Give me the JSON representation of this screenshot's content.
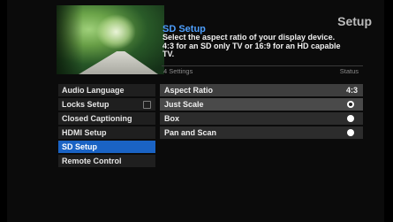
{
  "screen": {
    "title": "Setup"
  },
  "description": {
    "title": "SD Setup",
    "body": "Select the aspect ratio of your display device. 4:3 for an SD only TV or 16:9 for an HD capable TV."
  },
  "info": {
    "left": "4 Settings",
    "right": "Status"
  },
  "menu": {
    "items": [
      {
        "label": "Audio Language"
      },
      {
        "label": "Locks Setup"
      },
      {
        "label": "Closed Captioning"
      },
      {
        "label": "HDMI Setup"
      },
      {
        "label": "SD Setup"
      },
      {
        "label": "Remote Control"
      }
    ],
    "selected": "SD Setup"
  },
  "options": {
    "header": {
      "label": "Aspect Ratio",
      "value": "4:3"
    },
    "items": [
      {
        "label": "Just Scale"
      },
      {
        "label": "Box"
      },
      {
        "label": "Pan and Scan"
      }
    ],
    "selected": "Just Scale"
  },
  "colors": {
    "accent": "#1a63c4",
    "title_blue": "#4ea0ff"
  },
  "icons": [
    "lock-icon",
    "radio-selected-icon",
    "radio-icon"
  ]
}
